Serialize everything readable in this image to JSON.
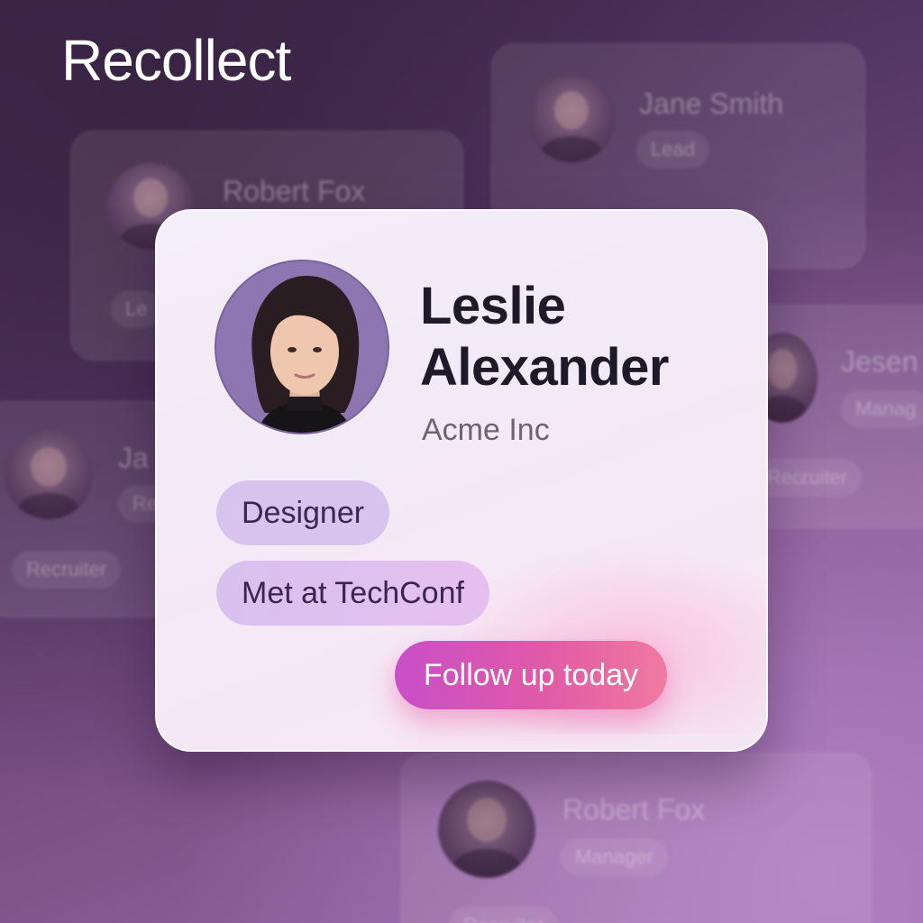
{
  "app": {
    "title": "Recollect"
  },
  "background_cards": [
    {
      "name": "Jane Smith",
      "tag": "Lead"
    },
    {
      "name": "Robert Fox",
      "tag": "Le"
    },
    {
      "name": "Jesen",
      "tag": "Manag",
      "tag2": "Recruiter"
    },
    {
      "name": "Ja",
      "tag": "Re",
      "tag2": "Recruiter"
    },
    {
      "name": "Robert Fox",
      "tag": "Manager",
      "tag2": "Recruiter"
    }
  ],
  "contact": {
    "first_name": "Leslie",
    "last_name": "Alexander",
    "company": "Acme Inc",
    "tags": [
      "Designer",
      "Met at TechConf"
    ],
    "action_label": "Follow up today"
  },
  "colors": {
    "accent_start": "#c84fc8",
    "accent_end": "#f07aa0",
    "tag_bg": "#d7c3ee",
    "avatar_bg": "#8e76b3"
  }
}
